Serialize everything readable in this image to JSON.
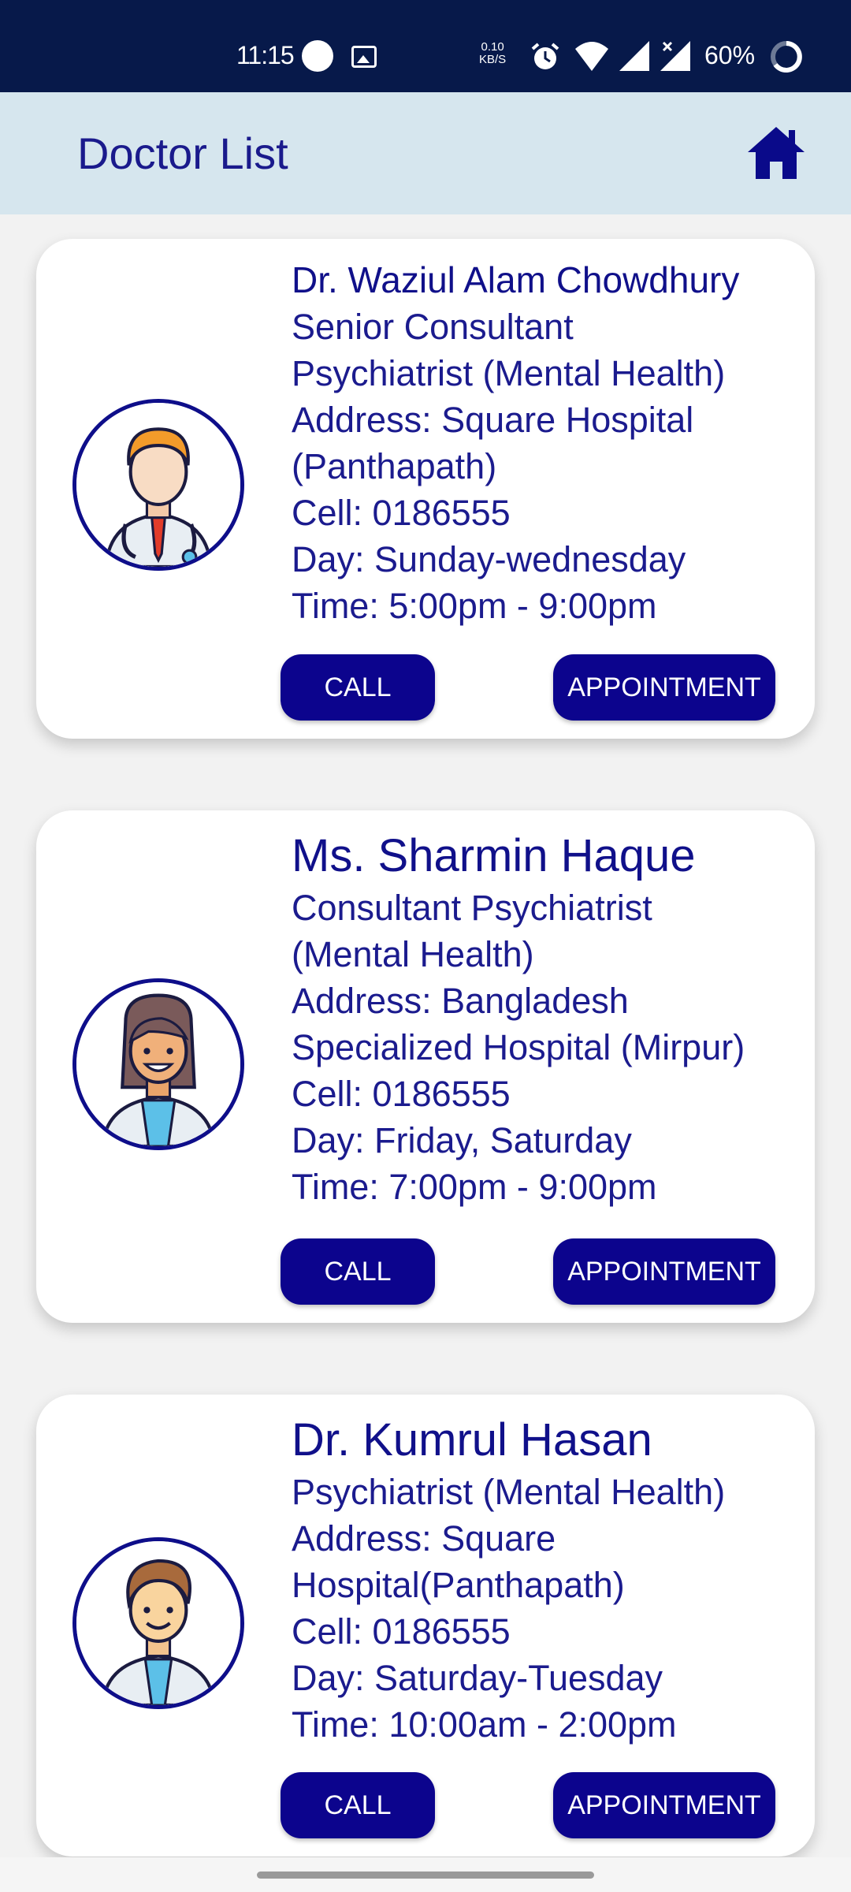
{
  "status_bar": {
    "time": "11:15",
    "net_speed_value": "0.10",
    "net_speed_unit": "KB/S",
    "battery": "60%",
    "icons": [
      "circle-notification-icon",
      "image-icon",
      "alarm-icon",
      "wifi-icon",
      "signal-icon",
      "signal-no-data-icon",
      "battery-icon"
    ]
  },
  "app_bar": {
    "title": "Doctor List",
    "home_icon": "home-icon",
    "accent_color": "#d6e6ee"
  },
  "doctors": [
    {
      "name": "Dr. Waziul Alam Chowdhury",
      "lines": [
        "Senior Consultant",
        "Psychiatrist (Mental Health)",
        "Address: Square Hospital",
        "(Panthapath)",
        "Cell: 0186555",
        "Day: Sunday-wednesday",
        "Time: 5:00pm - 9:00pm"
      ],
      "call_label": "CALL",
      "appointment_label": "APPOINTMENT"
    },
    {
      "name": "Ms. Sharmin Haque",
      "lines": [
        "Consultant Psychiatrist",
        "(Mental Health)",
        "Address: Bangladesh",
        "Specialized Hospital (Mirpur)",
        "Cell: 0186555",
        "Day: Friday, Saturday",
        "Time: 7:00pm - 9:00pm"
      ],
      "call_label": "CALL",
      "appointment_label": "APPOINTMENT"
    },
    {
      "name": "Dr. Kumrul Hasan",
      "lines": [
        "Psychiatrist (Mental Health)",
        "Address: Square",
        "Hospital(Panthapath)",
        "Cell: 0186555",
        "Day: Saturday-Tuesday",
        "Time: 10:00am - 2:00pm"
      ],
      "call_label": "CALL",
      "appointment_label": "APPOINTMENT"
    }
  ],
  "colors": {
    "status_bar": "#07194a",
    "button": "#0c048d",
    "text": "#12128a"
  }
}
